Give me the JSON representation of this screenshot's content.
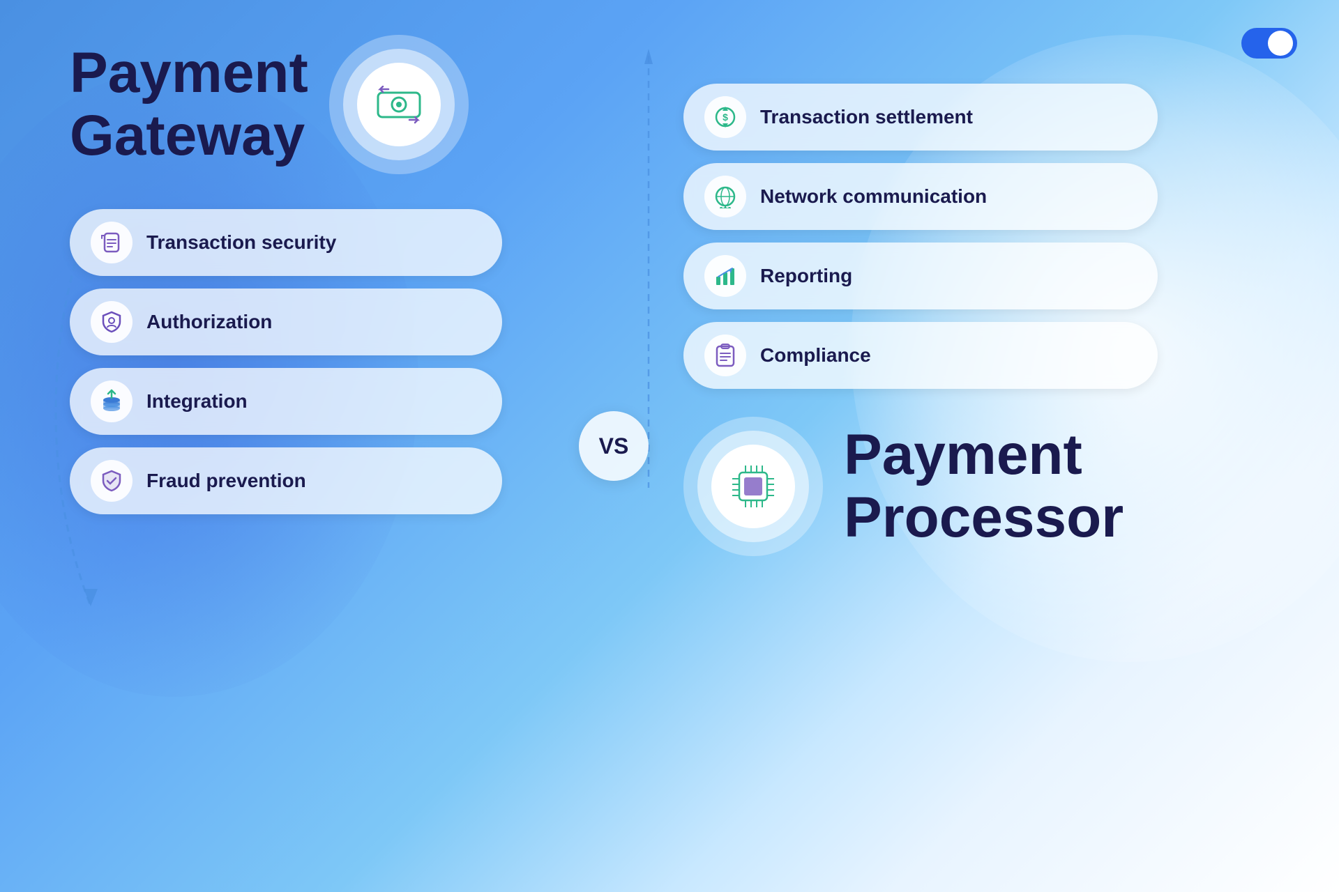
{
  "page": {
    "background": "gradient-blue-white"
  },
  "toggle": {
    "state": "on",
    "aria_label": "Toggle"
  },
  "vs_label": "VS",
  "left": {
    "title_line1": "Payment",
    "title_line2": "Gateway",
    "features": [
      {
        "id": "transaction-security",
        "label": "Transaction security",
        "icon": "📋",
        "icon_color": "#7c5cbf"
      },
      {
        "id": "authorization",
        "label": "Authorization",
        "icon": "🛡",
        "icon_color": "#6b4fbb"
      },
      {
        "id": "integration",
        "label": "Integration",
        "icon": "🪙",
        "icon_color": "#4a90e2"
      },
      {
        "id": "fraud-prevention",
        "label": "Fraud prevention",
        "icon": "🛡",
        "icon_color": "#7c5cbf"
      }
    ]
  },
  "right": {
    "title_line1": "Payment",
    "title_line2": "Processor",
    "features": [
      {
        "id": "transaction-settlement",
        "label": "Transaction settlement",
        "icon": "💲",
        "icon_color": "#2db88a"
      },
      {
        "id": "network-communication",
        "label": "Network communication",
        "icon": "🌐",
        "icon_color": "#2db88a"
      },
      {
        "id": "reporting",
        "label": "Reporting",
        "icon": "📊",
        "icon_color": "#2db88a"
      },
      {
        "id": "compliance",
        "label": "Compliance",
        "icon": "📋",
        "icon_color": "#7c5cbf"
      }
    ]
  }
}
